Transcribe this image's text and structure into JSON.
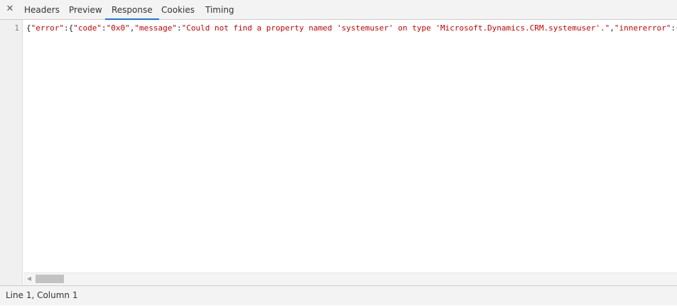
{
  "tabs": {
    "close_glyph": "✕",
    "items": [
      {
        "label": "Headers"
      },
      {
        "label": "Preview"
      },
      {
        "label": "Response"
      },
      {
        "label": "Cookies"
      },
      {
        "label": "Timing"
      }
    ],
    "active": "Response"
  },
  "editor": {
    "line_number": "1",
    "line_text": "{\"error\":{\"code\":\"0x0\",\"message\":\"Could not find a property named 'systemuser' on type 'Microsoft.Dynamics.CRM.systemuser'.\",\"innererror\":{",
    "tokens": [
      {
        "t": "{",
        "k": "punct"
      },
      {
        "t": "\"error\"",
        "k": "key"
      },
      {
        "t": ":",
        "k": "punct"
      },
      {
        "t": "{",
        "k": "punct"
      },
      {
        "t": "\"code\"",
        "k": "key"
      },
      {
        "t": ":",
        "k": "punct"
      },
      {
        "t": "\"0x0\"",
        "k": "str"
      },
      {
        "t": ",",
        "k": "punct"
      },
      {
        "t": "\"message\"",
        "k": "key"
      },
      {
        "t": ":",
        "k": "punct"
      },
      {
        "t": "\"Could not find a property named 'systemuser' on type 'Microsoft.Dynamics.CRM.systemuser'.\"",
        "k": "str"
      },
      {
        "t": ",",
        "k": "punct"
      },
      {
        "t": "\"innererror\"",
        "k": "key"
      },
      {
        "t": ":",
        "k": "punct"
      },
      {
        "t": "{",
        "k": "punct"
      }
    ]
  },
  "scrollbar": {
    "left_arrow_glyph": "◀"
  },
  "status": {
    "cursor_position": "Line 1, Column 1"
  },
  "colors": {
    "accent": "#1a73e8",
    "json_string": "#c80000",
    "punctuation": "#222222"
  }
}
